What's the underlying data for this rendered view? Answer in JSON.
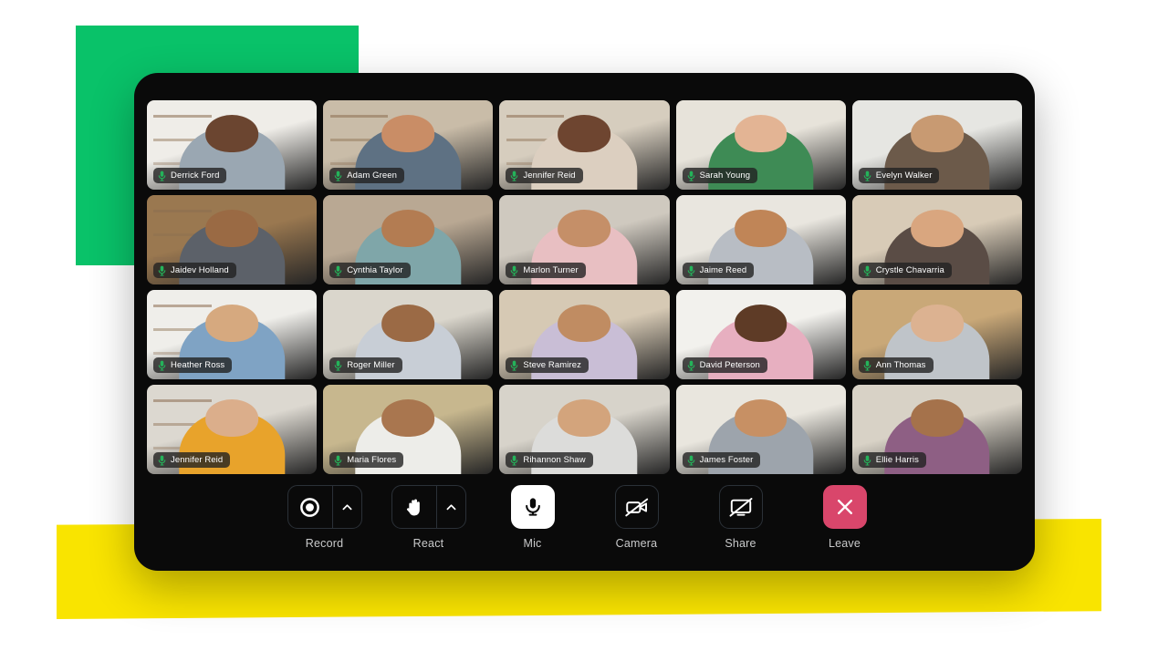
{
  "app": {
    "name": "video-conference-grid",
    "window_background": "#0A0A0A",
    "accent_green": "#09C269",
    "accent_yellow": "#F9E400",
    "leave_color": "#D9466B",
    "mic_indicator_color": "#24B35A"
  },
  "decorations": [
    {
      "name": "green-square",
      "color": "#09C269"
    },
    {
      "name": "yellow-banner",
      "color": "#F9E400"
    }
  ],
  "grid": {
    "columns": 5,
    "rows": 4,
    "participant_count": 20,
    "participants": [
      {
        "name": "Derrick Ford",
        "mic": "mic-on-icon",
        "skin": "#6B4530",
        "shirt": "#9AA7B2",
        "wall": "#EFEDE8",
        "shelf": true
      },
      {
        "name": "Adam Green",
        "mic": "mic-on-icon",
        "skin": "#C98D66",
        "shirt": "#5E7183",
        "wall": "#C9BCA8",
        "shelf": true
      },
      {
        "name": "Jennifer Reid",
        "mic": "mic-on-icon",
        "skin": "#6E4530",
        "shirt": "#DCCFC0",
        "wall": "#D6CDBE",
        "shelf": true
      },
      {
        "name": "Sarah Young",
        "mic": "mic-on-icon",
        "skin": "#E3B494",
        "shirt": "#3E8B55",
        "wall": "#E7E3DA",
        "shelf": false
      },
      {
        "name": "Evelyn Walker",
        "mic": "mic-on-icon",
        "skin": "#C89A72",
        "shirt": "#6C5A4A",
        "wall": "#E6E6E2",
        "shelf": false
      },
      {
        "name": "Jaidev Holland",
        "mic": "mic-on-icon",
        "skin": "#9A6A44",
        "shirt": "#5C6169",
        "wall": "#9A7850",
        "shelf": true
      },
      {
        "name": "Cynthia Taylor",
        "mic": "mic-on-icon",
        "skin": "#B37C52",
        "shirt": "#7FA6A9",
        "wall": "#B9A893",
        "shelf": false
      },
      {
        "name": "Marlon Turner",
        "mic": "mic-on-icon",
        "skin": "#C58F68",
        "shirt": "#E8BFC2",
        "wall": "#CFC9BF",
        "shelf": false
      },
      {
        "name": "Jaime Reed",
        "mic": "mic-on-icon",
        "skin": "#C08557",
        "shirt": "#B8BDC4",
        "wall": "#E9E6DF",
        "shelf": false
      },
      {
        "name": "Crystle Chavarria",
        "mic": "mic-on-icon",
        "skin": "#D9A67F",
        "shirt": "#5A4C45",
        "wall": "#D8CBB7",
        "shelf": false
      },
      {
        "name": "Heather Ross",
        "mic": "mic-on-icon",
        "skin": "#D6A97F",
        "shirt": "#7FA3C4",
        "wall": "#EFEEEA",
        "shelf": true
      },
      {
        "name": "Roger Miller",
        "mic": "mic-on-icon",
        "skin": "#9B6A45",
        "shirt": "#C8CED6",
        "wall": "#DAD6CC",
        "shelf": false
      },
      {
        "name": "Steve Ramirez",
        "mic": "mic-on-icon",
        "skin": "#C08C62",
        "shirt": "#C9BED6",
        "wall": "#D6C9B4",
        "shelf": false
      },
      {
        "name": "David Peterson",
        "mic": "mic-on-icon",
        "skin": "#5E3B26",
        "shirt": "#E7AFC0",
        "wall": "#F2F1ED",
        "shelf": false
      },
      {
        "name": "Ann Thomas",
        "mic": "mic-on-icon",
        "skin": "#DCB291",
        "shirt": "#BFC4C9",
        "wall": "#C9A878",
        "shelf": false
      },
      {
        "name": "Jennifer Reid",
        "mic": "mic-on-icon",
        "skin": "#DBAE8B",
        "shirt": "#E8A32B",
        "wall": "#DCD8D0",
        "shelf": true
      },
      {
        "name": "Maria Flores",
        "mic": "mic-on-icon",
        "skin": "#A9764F",
        "shirt": "#EDEDE9",
        "wall": "#C7B78E",
        "shelf": false
      },
      {
        "name": "Rihannon Shaw",
        "mic": "mic-on-icon",
        "skin": "#D3A47C",
        "shirt": "#DCDCDA",
        "wall": "#D7D3CA",
        "shelf": false
      },
      {
        "name": "James Foster",
        "mic": "mic-on-icon",
        "skin": "#C79064",
        "shirt": "#9DA4AC",
        "wall": "#E9E6DE",
        "shelf": false
      },
      {
        "name": "Ellie Harris",
        "mic": "mic-on-icon",
        "skin": "#A5724B",
        "shirt": "#8E5F84",
        "wall": "#D8D2C6",
        "shelf": false
      }
    ]
  },
  "toolbar": {
    "controls": [
      {
        "label": "Record",
        "icon": "record-icon",
        "type": "split",
        "state": "off",
        "caret": "chevron-up-icon"
      },
      {
        "label": "React",
        "icon": "raised-hand-icon",
        "type": "split",
        "state": "off",
        "caret": "chevron-up-icon"
      },
      {
        "label": "Mic",
        "icon": "microphone-icon",
        "type": "solo",
        "state": "active"
      },
      {
        "label": "Camera",
        "icon": "camera-off-icon",
        "type": "solo",
        "state": "off"
      },
      {
        "label": "Share",
        "icon": "screen-share-off-icon",
        "type": "solo",
        "state": "off"
      },
      {
        "label": "Leave",
        "icon": "close-x-icon",
        "type": "solo",
        "state": "danger"
      }
    ]
  }
}
